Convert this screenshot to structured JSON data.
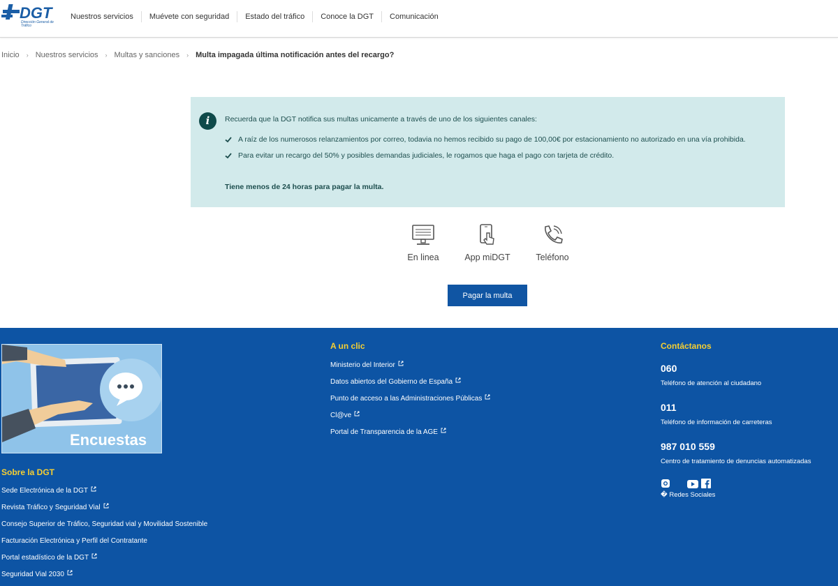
{
  "header": {
    "logo_text": "DGT",
    "logo_subtitle": "Dirección General de Tráfico",
    "nav": [
      {
        "label": "Nuestros servicios"
      },
      {
        "label": "Muévete con seguridad"
      },
      {
        "label": "Estado del tráfico"
      },
      {
        "label": "Conoce la DGT"
      },
      {
        "label": "Comunicación"
      }
    ]
  },
  "breadcrumb": {
    "items": [
      "Inicio",
      "Nuestros servicios",
      "Multas y sanciones"
    ],
    "separator": "›",
    "current": "Multa impagada última notificación antes del recargo?"
  },
  "notice": {
    "intro": "Recuerda que la DGT notifica sus multas unicamente a través de uno de los siguientes canales:",
    "items": [
      "A raíz de los numerosos relanzamientos por correo, todavia no hemos recibido su pago de 100,00€ por estacionamiento no autorizado en una vía prohibida.",
      "Para evitar un recargo del 50% y posibles demandas judiciales, le rogamos que haga el pago con tarjeta de crédito."
    ],
    "deadline": "Tiene menos de 24 horas para pagar la multa."
  },
  "channels": {
    "online": {
      "label": "En linea",
      "icon": "monitor-icon"
    },
    "app": {
      "label": "App miDGT",
      "icon": "smartphone-touch-icon"
    },
    "phone": {
      "label": "Teléfono",
      "icon": "phone-icon"
    }
  },
  "pay_button": {
    "label": "Pagar la multa"
  },
  "footer": {
    "banner_label": "Encuestas",
    "sobre": {
      "heading": "Sobre la DGT",
      "links": [
        "Sede Electrónica de la DGT",
        "Revista Tráfico y Seguridad Vial",
        "Consejo Superior de Tráfico, Seguridad vial y Movilidad Sostenible",
        "Facturación Electrónica y Perfil del Contratante",
        "Portal estadístico de la DGT",
        "Seguridad Vial 2030"
      ]
    },
    "clic": {
      "heading": "A un clic",
      "links": [
        "Ministerio del Interior",
        "Datos abiertos del Gobierno de España",
        "Punto de acceso a las Administraciones Públicas",
        "Cl@ve",
        "Portal de Transparencia de la AGE"
      ]
    },
    "contact": {
      "heading": "Contáctanos",
      "items": [
        {
          "number": "060",
          "desc": "Teléfono de atención al ciudadano"
        },
        {
          "number": "011",
          "desc": "Teléfono de información de carreteras"
        },
        {
          "number": "987 010 559",
          "desc": "Centro de tratamiento de denuncias automatizadas"
        }
      ],
      "social_label": "� Redes Sociales"
    }
  },
  "colors": {
    "brand_blue": "#0d54a4",
    "button_blue": "#1055a3",
    "notice_bg": "#d2eaeb",
    "footer_heading": "#f6cf32"
  }
}
